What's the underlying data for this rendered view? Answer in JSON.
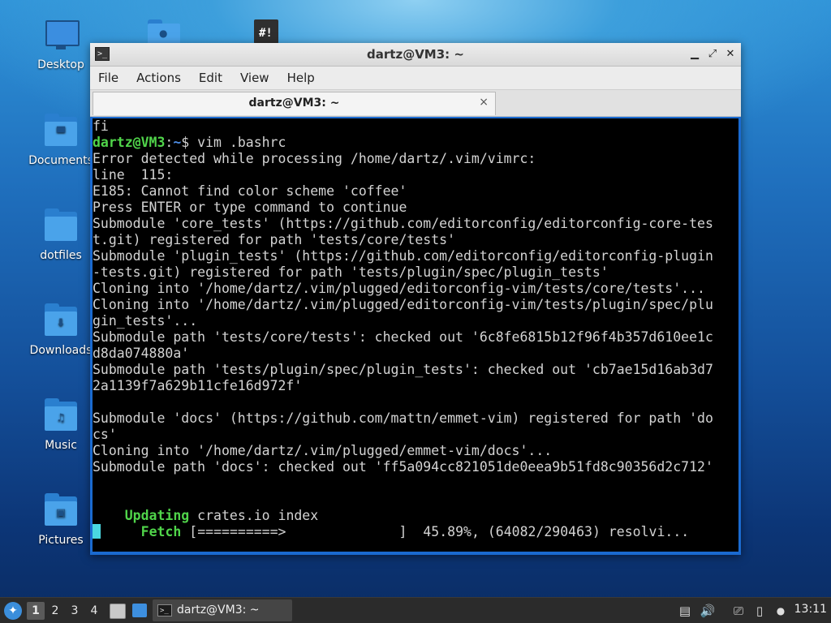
{
  "desktop": {
    "icons": [
      {
        "label": "Desktop",
        "icon": "desktop-folder-icon"
      },
      {
        "label": "Documents",
        "icon": "documents-folder-icon"
      },
      {
        "label": "dotfiles",
        "icon": "folder-icon"
      },
      {
        "label": "Downloads",
        "icon": "downloads-folder-icon"
      },
      {
        "label": "Music",
        "icon": "music-folder-icon"
      },
      {
        "label": "Pictures",
        "icon": "pictures-folder-icon"
      }
    ]
  },
  "window": {
    "title": "dartz@VM3: ~",
    "controls": {
      "minimize": "▁",
      "maximize": "⤢",
      "close": "✕"
    },
    "menu": [
      "File",
      "Actions",
      "Edit",
      "View",
      "Help"
    ],
    "tab": {
      "label": "dartz@VM3: ~",
      "close": "×"
    }
  },
  "terminal": {
    "prompt_user": "dartz@VM3",
    "prompt_sep": ":",
    "prompt_path": "~",
    "prompt_symbol": "$ ",
    "command": "vim .bashrc",
    "lines": [
      "fi",
      "",
      "Error detected while processing /home/dartz/.vim/vimrc:",
      "line  115:",
      "E185: Cannot find color scheme 'coffee'",
      "Press ENTER or type command to continue",
      "Submodule 'core_tests' (https://github.com/editorconfig/editorconfig-core-tes",
      "t.git) registered for path 'tests/core/tests'",
      "Submodule 'plugin_tests' (https://github.com/editorconfig/editorconfig-plugin",
      "-tests.git) registered for path 'tests/plugin/spec/plugin_tests'",
      "Cloning into '/home/dartz/.vim/plugged/editorconfig-vim/tests/core/tests'...",
      "Cloning into '/home/dartz/.vim/plugged/editorconfig-vim/tests/plugin/spec/plu",
      "gin_tests'...",
      "Submodule path 'tests/core/tests': checked out '6c8fe6815b12f96f4b357d610ee1c",
      "d8da074880a'",
      "Submodule path 'tests/plugin/spec/plugin_tests': checked out 'cb7ae15d16ab3d7",
      "2a1139f7a629b11cfe16d972f'",
      "",
      "Submodule 'docs' (https://github.com/mattn/emmet-vim) registered for path 'do",
      "cs'",
      "Cloning into '/home/dartz/.vim/plugged/emmet-vim/docs'...",
      "Submodule path 'docs': checked out 'ff5a094cc821051de0eea9b51fd8c90356d2c712'",
      "",
      ""
    ],
    "updating_label": "Updating",
    "updating_text": " crates.io index",
    "fetch_label": "Fetch",
    "fetch_bar": " [==========>              ]",
    "fetch_status": "  45.89%, (64082/290463) resolvi..."
  },
  "taskbar": {
    "workspaces": [
      "1",
      "2",
      "3",
      "4"
    ],
    "active_workspace": "1",
    "task_label": "dartz@VM3: ~",
    "clock": "13:11"
  }
}
